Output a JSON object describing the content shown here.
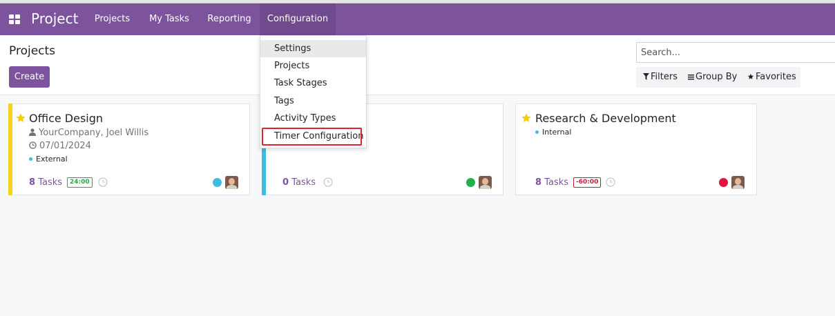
{
  "navbar": {
    "app_title": "Project",
    "menu": [
      "Projects",
      "My Tasks",
      "Reporting",
      "Configuration"
    ],
    "active": "Configuration",
    "bg_color": "#7c539c"
  },
  "control_panel": {
    "breadcrumb": "Projects",
    "create_label": "Create",
    "search_placeholder": "Search...",
    "filters_label": "Filters",
    "group_by_label": "Group By",
    "favorites_label": "Favorites"
  },
  "configuration_menu": {
    "items": [
      "Settings",
      "Projects",
      "Task Stages",
      "Tags",
      "Activity Types",
      "Timer Configuration"
    ],
    "hovered": "Settings",
    "highlighted": "Timer Configuration",
    "highlight_color": "#d9242b"
  },
  "projects": [
    {
      "title": "Office Design",
      "favorite": true,
      "customer": "YourCompany, Joel Willis",
      "date": "07/01/2024",
      "tag": "External",
      "task_count": "8",
      "tasks_label": "Tasks",
      "timer": "24:00",
      "timer_color": "#28a745",
      "status_color": "#3fbcdf",
      "color_bar": "#f7d31e"
    },
    {
      "title": "",
      "favorite": false,
      "task_count": "0",
      "tasks_label": "Tasks",
      "status_color": "#21b14b",
      "color_bar": "#3fbcdf"
    },
    {
      "title": "Research & Development",
      "favorite": true,
      "tag": "Internal",
      "task_count": "8",
      "tasks_label": "Tasks",
      "timer": "-60:00",
      "timer_color": "#c21d3f",
      "status_color": "#e3133f"
    }
  ]
}
